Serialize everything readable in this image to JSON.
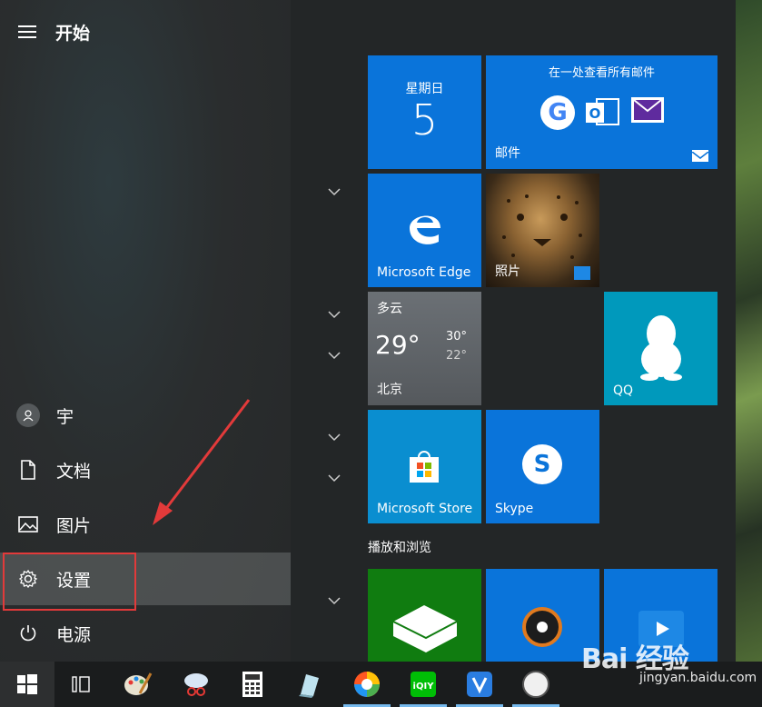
{
  "start_menu": {
    "title": "开始",
    "rail": [
      {
        "id": "user",
        "label": "宇",
        "icon": "user-avatar-icon"
      },
      {
        "id": "documents",
        "label": "文档",
        "icon": "document-icon"
      },
      {
        "id": "pictures",
        "label": "图片",
        "icon": "picture-icon"
      },
      {
        "id": "settings",
        "label": "设置",
        "icon": "gear-icon"
      },
      {
        "id": "power",
        "label": "电源",
        "icon": "power-icon"
      }
    ]
  },
  "tiles": {
    "calendar": {
      "weekday": "星期日",
      "day": "5"
    },
    "mail": {
      "header": "在一处查看所有邮件",
      "label": "邮件"
    },
    "edge": {
      "label": "Microsoft Edge"
    },
    "photos": {
      "label": "照片"
    },
    "weather": {
      "condition": "多云",
      "temp": "29°",
      "high": "30°",
      "low": "22°",
      "city": "北京"
    },
    "qq": {
      "label": "QQ"
    },
    "store": {
      "label": "Microsoft Store"
    },
    "skype": {
      "label": "Skype"
    },
    "group_label": "播放和浏览"
  },
  "colors": {
    "tile_blue": "#0a74da",
    "weather_gray": "#5c6165",
    "qq_teal": "#0099bc",
    "xbox_green": "#107c10",
    "highlight_red": "#e23a3a"
  },
  "watermark": {
    "logo": "Bai 经验",
    "url": "jingyan.baidu.com"
  }
}
